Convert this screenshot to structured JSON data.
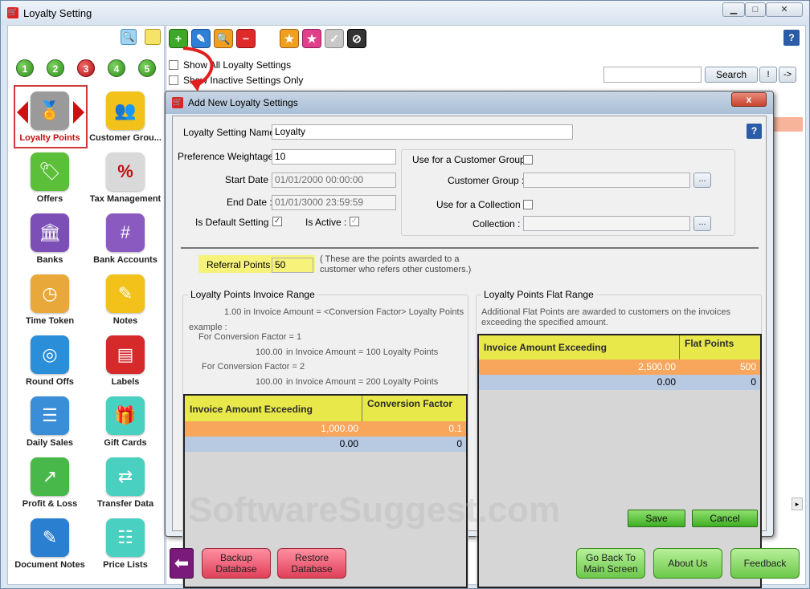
{
  "window": {
    "title": "Loyalty Setting",
    "min": "▁",
    "max": "□",
    "close": "✕"
  },
  "nav": {
    "steps": [
      "1",
      "2",
      "3",
      "4",
      "5"
    ]
  },
  "tiles": [
    {
      "label": "Loyalty Points",
      "icon": "award-icon",
      "color": "#9a9a9a"
    },
    {
      "label": "Customer Grou...",
      "icon": "customers-icon",
      "color": "#f3c21a"
    },
    {
      "label": "Offers",
      "icon": "offer-icon",
      "color": "#5bbf3a"
    },
    {
      "label": "Tax Management",
      "icon": "percent-icon",
      "color": "#d9d9d9"
    },
    {
      "label": "Banks",
      "icon": "bank-icon",
      "color": "#7b4fb5"
    },
    {
      "label": "Bank Accounts",
      "icon": "card-icon",
      "color": "#8a5ac0"
    },
    {
      "label": "Time Token",
      "icon": "clock-icon",
      "color": "#e8a93a"
    },
    {
      "label": "Notes",
      "icon": "notes-icon",
      "color": "#f3c21a"
    },
    {
      "label": "Round Offs",
      "icon": "target-icon",
      "color": "#2a8ed8"
    },
    {
      "label": "Labels",
      "icon": "label-icon",
      "color": "#d62a2a"
    },
    {
      "label": "Daily Sales",
      "icon": "document-icon",
      "color": "#3a8ed8"
    },
    {
      "label": "Gift Cards",
      "icon": "gift-icon",
      "color": "#4ad0c0"
    },
    {
      "label": "Profit & Loss",
      "icon": "chart-icon",
      "color": "#49b84a"
    },
    {
      "label": "Transfer Data",
      "icon": "transfer-icon",
      "color": "#4ad0c0"
    },
    {
      "label": "Document Notes",
      "icon": "edit-icon",
      "color": "#2a7fd0"
    },
    {
      "label": "Price Lists",
      "icon": "pricelist-icon",
      "color": "#4ad0c0"
    }
  ],
  "toolbar": {
    "show_all": "Show All Loyalty Settings",
    "show_inactive": "Show Inactive Settings Only",
    "search_label": "Search",
    "excl": "!",
    "arrow": "->",
    "help": "?"
  },
  "dialog": {
    "title": "Add New Loyalty Settings",
    "close": "x",
    "help": "?",
    "name_label": "Loyalty Setting Name :",
    "name_value": "Loyalty",
    "weight_label": "Preference Weightage :",
    "weight_value": "10",
    "start_label": "Start Date :",
    "start_value": "01/01/2000  00:00:00",
    "end_label": "End Date :",
    "end_value": "01/01/3000  23:59:59",
    "default_label": "Is Default Setting :",
    "active_label": "Is Active :",
    "cust_group_use_label": "Use for a Customer Group :",
    "cust_group_label": "Customer Group :",
    "collection_use_label": "Use for a Collection :",
    "collection_label": "Collection :",
    "browse": "...",
    "referral_label": "Referral Points :",
    "referral_value": "50",
    "referral_note": "( These are the points awarded to a customer who refers other customers.)",
    "invoice_range": {
      "title": "Loyalty Points Invoice Range",
      "line1": "1.00 in Invoice Amount = <Conversion Factor> Loyalty Points",
      "line2": "example :",
      "line3": "For Conversion Factor = 1",
      "line4a": "100.00",
      "line4b": "in Invoice Amount = 100 Loyalty Points",
      "line5": "For Conversion Factor = 2",
      "line6a": "100.00",
      "line6b": "in Invoice Amount = 200 Loyalty Points",
      "col1": "Invoice Amount Exceeding",
      "col2": "Conversion Factor",
      "rows": [
        {
          "a": "1,000.00",
          "b": "0.1"
        },
        {
          "a": "0.00",
          "b": "0"
        }
      ]
    },
    "flat_range": {
      "title": "Loyalty Points Flat Range",
      "desc": "Additional Flat Points are awarded to customers on the invoices exceeding the specified amount.",
      "col1": "Invoice Amount Exceeding",
      "col2": "Flat Points",
      "rows": [
        {
          "a": "2,500.00",
          "b": "500"
        },
        {
          "a": "0.00",
          "b": "0"
        }
      ]
    },
    "save": "Save",
    "cancel": "Cancel"
  },
  "footer": {
    "backup": "Backup Database",
    "restore": "Restore Database",
    "goback": "Go Back To Main Screen",
    "about": "About Us",
    "feedback": "Feedback"
  },
  "watermark": "SoftwareSuggest.com"
}
